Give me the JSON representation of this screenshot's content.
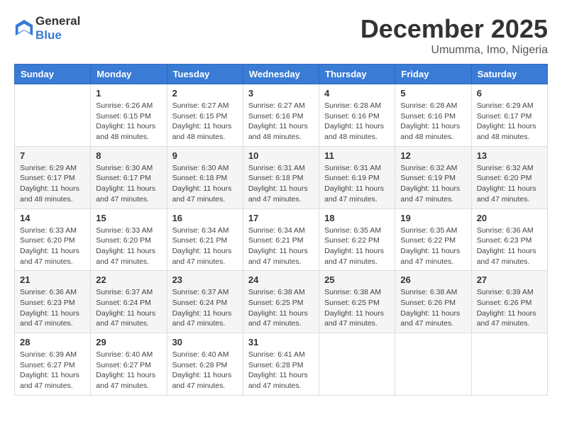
{
  "header": {
    "logo": {
      "general": "General",
      "blue": "Blue"
    },
    "title": "December 2025",
    "subtitle": "Umumma, Imo, Nigeria"
  },
  "calendar": {
    "days_of_week": [
      "Sunday",
      "Monday",
      "Tuesday",
      "Wednesday",
      "Thursday",
      "Friday",
      "Saturday"
    ],
    "weeks": [
      [
        {
          "day": "",
          "info": ""
        },
        {
          "day": "1",
          "info": "Sunrise: 6:26 AM\nSunset: 6:15 PM\nDaylight: 11 hours and 48 minutes."
        },
        {
          "day": "2",
          "info": "Sunrise: 6:27 AM\nSunset: 6:15 PM\nDaylight: 11 hours and 48 minutes."
        },
        {
          "day": "3",
          "info": "Sunrise: 6:27 AM\nSunset: 6:16 PM\nDaylight: 11 hours and 48 minutes."
        },
        {
          "day": "4",
          "info": "Sunrise: 6:28 AM\nSunset: 6:16 PM\nDaylight: 11 hours and 48 minutes."
        },
        {
          "day": "5",
          "info": "Sunrise: 6:28 AM\nSunset: 6:16 PM\nDaylight: 11 hours and 48 minutes."
        },
        {
          "day": "6",
          "info": "Sunrise: 6:29 AM\nSunset: 6:17 PM\nDaylight: 11 hours and 48 minutes."
        }
      ],
      [
        {
          "day": "7",
          "info": "Sunrise: 6:29 AM\nSunset: 6:17 PM\nDaylight: 11 hours and 48 minutes."
        },
        {
          "day": "8",
          "info": "Sunrise: 6:30 AM\nSunset: 6:17 PM\nDaylight: 11 hours and 47 minutes."
        },
        {
          "day": "9",
          "info": "Sunrise: 6:30 AM\nSunset: 6:18 PM\nDaylight: 11 hours and 47 minutes."
        },
        {
          "day": "10",
          "info": "Sunrise: 6:31 AM\nSunset: 6:18 PM\nDaylight: 11 hours and 47 minutes."
        },
        {
          "day": "11",
          "info": "Sunrise: 6:31 AM\nSunset: 6:19 PM\nDaylight: 11 hours and 47 minutes."
        },
        {
          "day": "12",
          "info": "Sunrise: 6:32 AM\nSunset: 6:19 PM\nDaylight: 11 hours and 47 minutes."
        },
        {
          "day": "13",
          "info": "Sunrise: 6:32 AM\nSunset: 6:20 PM\nDaylight: 11 hours and 47 minutes."
        }
      ],
      [
        {
          "day": "14",
          "info": "Sunrise: 6:33 AM\nSunset: 6:20 PM\nDaylight: 11 hours and 47 minutes."
        },
        {
          "day": "15",
          "info": "Sunrise: 6:33 AM\nSunset: 6:20 PM\nDaylight: 11 hours and 47 minutes."
        },
        {
          "day": "16",
          "info": "Sunrise: 6:34 AM\nSunset: 6:21 PM\nDaylight: 11 hours and 47 minutes."
        },
        {
          "day": "17",
          "info": "Sunrise: 6:34 AM\nSunset: 6:21 PM\nDaylight: 11 hours and 47 minutes."
        },
        {
          "day": "18",
          "info": "Sunrise: 6:35 AM\nSunset: 6:22 PM\nDaylight: 11 hours and 47 minutes."
        },
        {
          "day": "19",
          "info": "Sunrise: 6:35 AM\nSunset: 6:22 PM\nDaylight: 11 hours and 47 minutes."
        },
        {
          "day": "20",
          "info": "Sunrise: 6:36 AM\nSunset: 6:23 PM\nDaylight: 11 hours and 47 minutes."
        }
      ],
      [
        {
          "day": "21",
          "info": "Sunrise: 6:36 AM\nSunset: 6:23 PM\nDaylight: 11 hours and 47 minutes."
        },
        {
          "day": "22",
          "info": "Sunrise: 6:37 AM\nSunset: 6:24 PM\nDaylight: 11 hours and 47 minutes."
        },
        {
          "day": "23",
          "info": "Sunrise: 6:37 AM\nSunset: 6:24 PM\nDaylight: 11 hours and 47 minutes."
        },
        {
          "day": "24",
          "info": "Sunrise: 6:38 AM\nSunset: 6:25 PM\nDaylight: 11 hours and 47 minutes."
        },
        {
          "day": "25",
          "info": "Sunrise: 6:38 AM\nSunset: 6:25 PM\nDaylight: 11 hours and 47 minutes."
        },
        {
          "day": "26",
          "info": "Sunrise: 6:38 AM\nSunset: 6:26 PM\nDaylight: 11 hours and 47 minutes."
        },
        {
          "day": "27",
          "info": "Sunrise: 6:39 AM\nSunset: 6:26 PM\nDaylight: 11 hours and 47 minutes."
        }
      ],
      [
        {
          "day": "28",
          "info": "Sunrise: 6:39 AM\nSunset: 6:27 PM\nDaylight: 11 hours and 47 minutes."
        },
        {
          "day": "29",
          "info": "Sunrise: 6:40 AM\nSunset: 6:27 PM\nDaylight: 11 hours and 47 minutes."
        },
        {
          "day": "30",
          "info": "Sunrise: 6:40 AM\nSunset: 6:28 PM\nDaylight: 11 hours and 47 minutes."
        },
        {
          "day": "31",
          "info": "Sunrise: 6:41 AM\nSunset: 6:28 PM\nDaylight: 11 hours and 47 minutes."
        },
        {
          "day": "",
          "info": ""
        },
        {
          "day": "",
          "info": ""
        },
        {
          "day": "",
          "info": ""
        }
      ]
    ]
  }
}
